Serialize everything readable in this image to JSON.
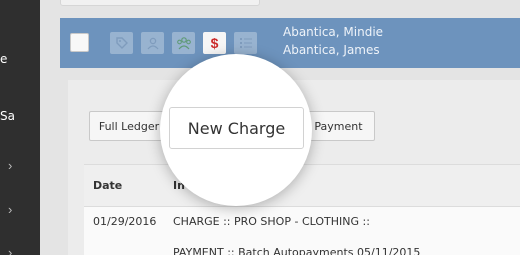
{
  "sidebar": {
    "items": [
      {
        "text": "e"
      },
      {
        "text": "Sa"
      },
      {
        "chevron": "›"
      },
      {
        "chevron": "›"
      },
      {
        "chevron": "›"
      }
    ]
  },
  "header": {
    "icons": [
      "tag-icon",
      "user-icon",
      "group-icon",
      "dollar-icon",
      "list-icon"
    ],
    "dollar_glyph": "$",
    "names": [
      "Abantica, Mindie",
      "Abantica, James"
    ]
  },
  "toolbar": {
    "full_ledger_label": "Full Ledger",
    "new_charge_label": "New Charge",
    "payment_label": "Payment"
  },
  "table": {
    "headers": [
      "Date",
      "In"
    ],
    "rows": [
      {
        "date": "01/29/2016",
        "info": "CHARGE :: PRO SHOP - CLOTHING ::"
      },
      {
        "date": "",
        "info": "PAYMENT :: Batch Autopayments 05/11/2015"
      }
    ]
  },
  "colors": {
    "header_blue": "#6d93bd",
    "sidebar_dark": "#2f2f2f",
    "dollar_red": "#cc2b2b"
  }
}
